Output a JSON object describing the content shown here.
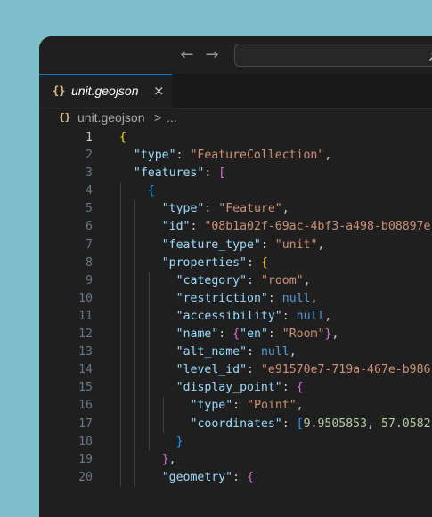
{
  "window": {
    "tab": {
      "icon": "{}",
      "label": "unit.geojson",
      "close": "×"
    },
    "breadcrumb": {
      "icon": "{}",
      "file": "unit.geojson",
      "separator": ">",
      "more": "..."
    },
    "nav": {
      "back": "←",
      "forward": "→"
    }
  },
  "editor": {
    "active_line": 1,
    "lines": [
      {
        "n": "1",
        "t": "{"
      },
      {
        "n": "2",
        "t": "  \"type\": \"FeatureCollection\","
      },
      {
        "n": "3",
        "t": "  \"features\": ["
      },
      {
        "n": "4",
        "t": "    {"
      },
      {
        "n": "5",
        "t": "      \"type\": \"Feature\","
      },
      {
        "n": "6",
        "t": "      \"id\": \"08b1a02f-69ac-4bf3-a498-b08897e"
      },
      {
        "n": "7",
        "t": "      \"feature_type\": \"unit\","
      },
      {
        "n": "8",
        "t": "      \"properties\": {"
      },
      {
        "n": "9",
        "t": "        \"category\": \"room\","
      },
      {
        "n": "10",
        "t": "        \"restriction\": null,"
      },
      {
        "n": "11",
        "t": "        \"accessibility\": null,"
      },
      {
        "n": "12",
        "t": "        \"name\": {\"en\": \"Room\"},"
      },
      {
        "n": "13",
        "t": "        \"alt_name\": null,"
      },
      {
        "n": "14",
        "t": "        \"level_id\": \"e91570e7-719a-467e-b986"
      },
      {
        "n": "15",
        "t": "        \"display_point\": {"
      },
      {
        "n": "16",
        "t": "          \"type\": \"Point\","
      },
      {
        "n": "17",
        "t": "          \"coordinates\": [9.9505853, 57.0582"
      },
      {
        "n": "18",
        "t": "        }"
      },
      {
        "n": "19",
        "t": "      },"
      },
      {
        "n": "20",
        "t": "      \"geometry\": {"
      }
    ]
  }
}
